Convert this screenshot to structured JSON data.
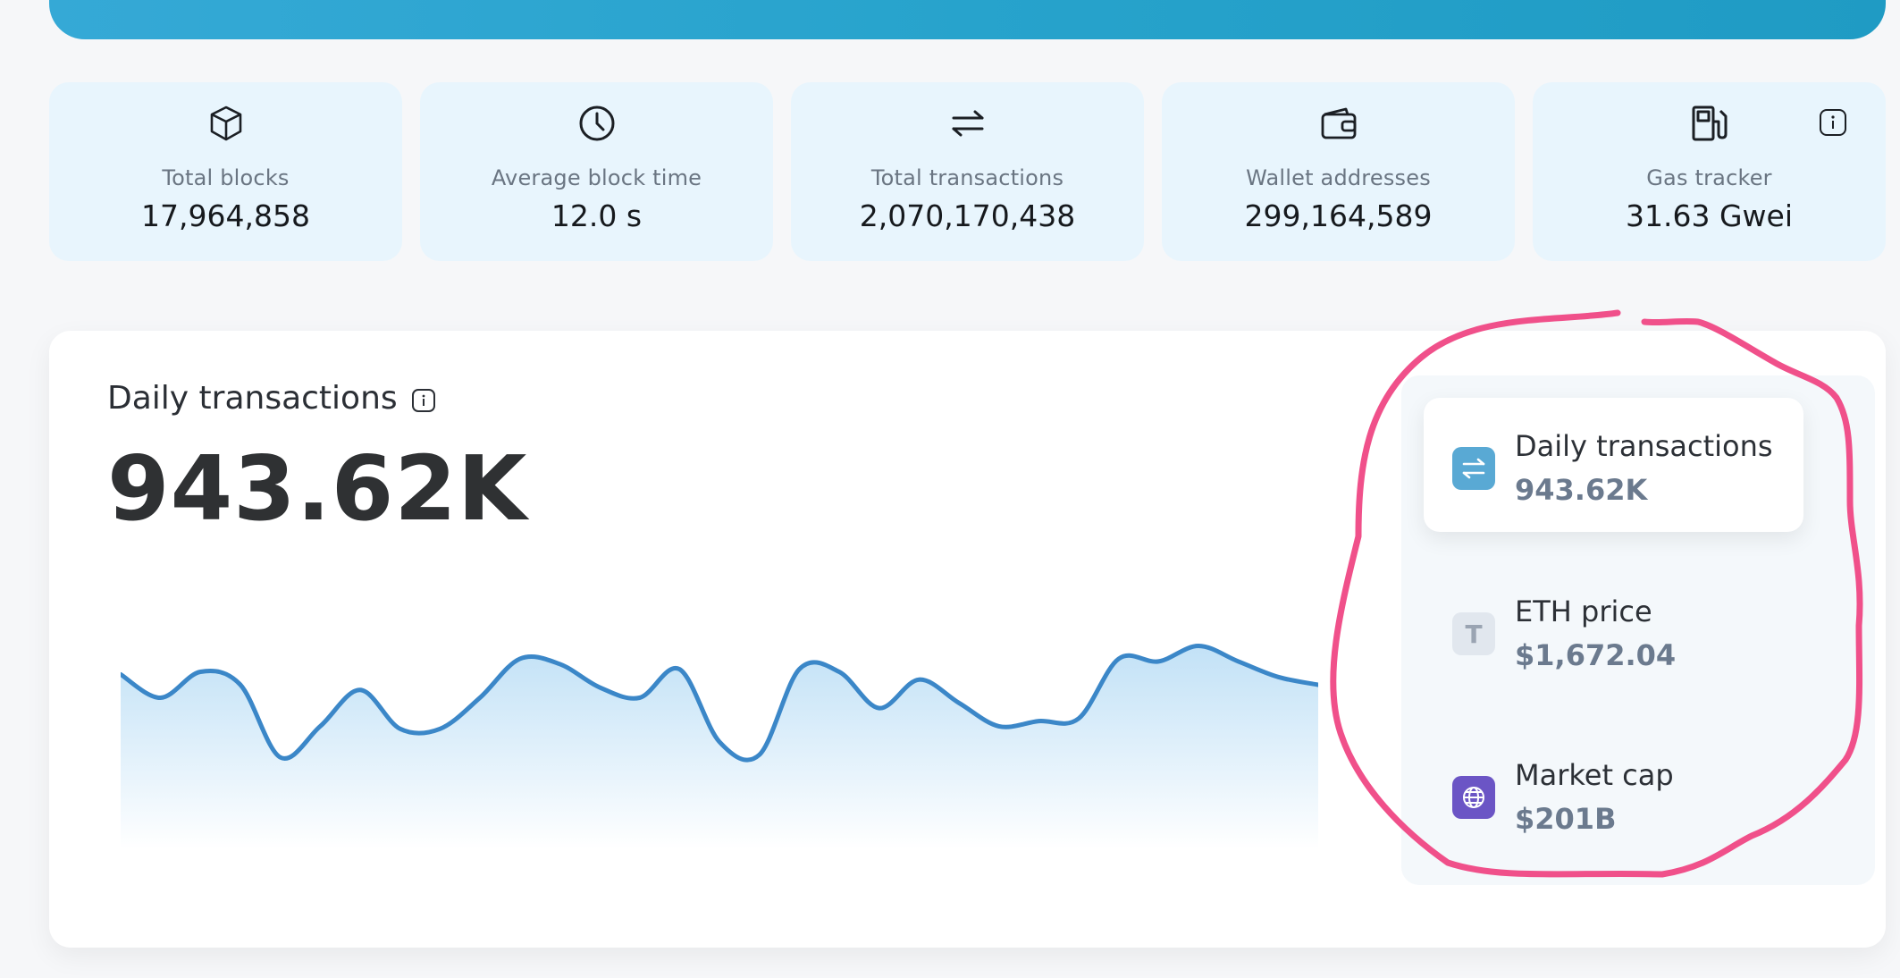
{
  "stats": [
    {
      "icon": "cube-icon",
      "label": "Total blocks",
      "value": "17,964,858"
    },
    {
      "icon": "clock-icon",
      "label": "Average block time",
      "value": "12.0 s"
    },
    {
      "icon": "transfer-arrows-icon",
      "label": "Total transactions",
      "value": "2,070,170,438"
    },
    {
      "icon": "wallet-icon",
      "label": "Wallet addresses",
      "value": "299,164,589"
    },
    {
      "icon": "gas-pump-icon",
      "label": "Gas tracker",
      "value": "31.63 Gwei"
    }
  ],
  "chart": {
    "title": "Daily transactions",
    "current_value": "943.62K"
  },
  "chart_data": {
    "type": "area",
    "title": "Daily transactions",
    "xlabel": "",
    "ylabel": "",
    "grid": false,
    "x": [
      1,
      2,
      3,
      4,
      5,
      6,
      7,
      8,
      9,
      10,
      11,
      12,
      13,
      14,
      15,
      16,
      17,
      18,
      19,
      20,
      21,
      22,
      23,
      24,
      25,
      26,
      27,
      28,
      29,
      30,
      31
    ],
    "values": [
      0.64,
      0.55,
      0.65,
      0.6,
      0.32,
      0.44,
      0.58,
      0.43,
      0.43,
      0.55,
      0.7,
      0.68,
      0.59,
      0.55,
      0.66,
      0.38,
      0.33,
      0.66,
      0.65,
      0.51,
      0.62,
      0.53,
      0.44,
      0.46,
      0.47,
      0.7,
      0.69,
      0.75,
      0.69,
      0.63,
      0.6
    ],
    "series_color": "#3b87c8",
    "fill_color": "#cfe6f7"
  },
  "side_panel": {
    "items": [
      {
        "icon": "transfer-arrows-icon",
        "title": "Daily transactions",
        "value": "943.62K",
        "color": "#59a9d4"
      },
      {
        "icon": "eth-t-icon",
        "letter": "T",
        "title": "ETH price",
        "value": "$1,672.04",
        "color": "#e1e7ee"
      },
      {
        "icon": "globe-icon",
        "title": "Market cap",
        "value": "$201B",
        "color": "#6b55c5"
      }
    ]
  },
  "annotation_color": "#f0508a"
}
